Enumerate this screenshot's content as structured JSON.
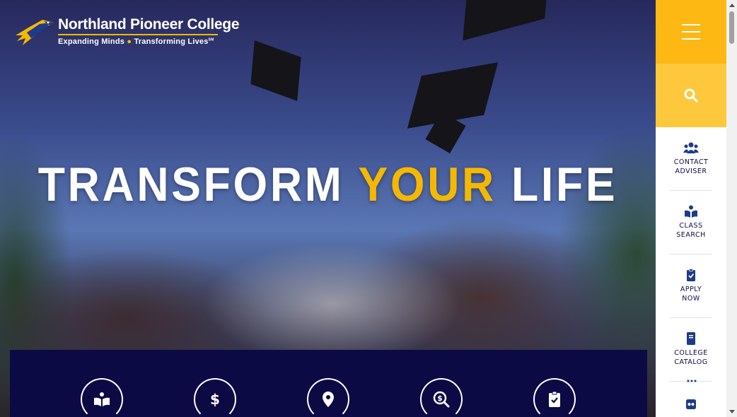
{
  "logo": {
    "name": "Northland Pioneer College",
    "tagline_part1": "Expanding Minds",
    "tagline_sep": "●",
    "tagline_part2": "Transforming Lives",
    "tagline_mark": "SM"
  },
  "hero": {
    "word1": "TRANSFORM",
    "word2": "YOUR",
    "word3": "LIFE"
  },
  "sidebar": {
    "menu_icon": "hamburger-icon",
    "search_icon": "search-icon",
    "quick_links": [
      {
        "icon": "users-icon",
        "line1": "CONTACT",
        "line2": "ADVISER"
      },
      {
        "icon": "book-reader-icon",
        "line1": "CLASS",
        "line2": "SEARCH"
      },
      {
        "icon": "clipboard-check-icon",
        "line1": "APPLY",
        "line2": "NOW"
      },
      {
        "icon": "book-icon",
        "line1": "COLLEGE",
        "line2": "CATALOG"
      }
    ],
    "more_icon": "ellipsis-icon",
    "social_icon": "flickr-icon"
  },
  "band": {
    "icons": [
      "book-reader-icon",
      "dollar-icon",
      "map-marker-icon",
      "search-dollar-icon",
      "clipboard-check-icon"
    ]
  },
  "colors": {
    "accent": "#fdb813",
    "accent_light": "#fdc83c",
    "navy": "#0c0a45",
    "white": "#ffffff"
  }
}
